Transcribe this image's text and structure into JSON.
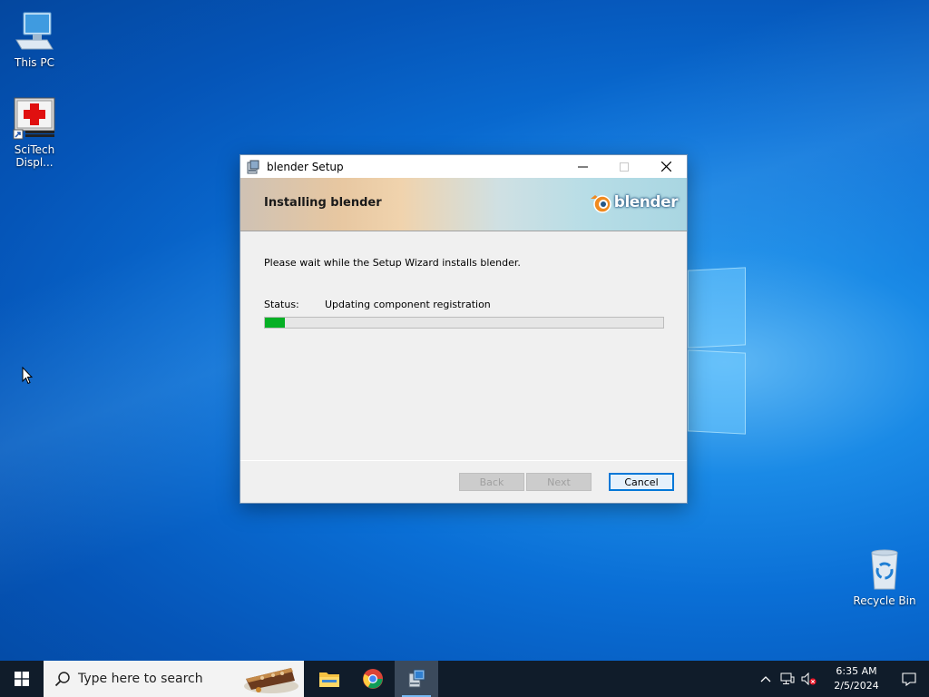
{
  "desktop": {
    "icons": [
      {
        "label": "This PC"
      },
      {
        "label": "SciTech Displ..."
      },
      {
        "label": "Recycle Bin"
      }
    ]
  },
  "dialog": {
    "title": "blender Setup",
    "banner_heading": "Installing blender",
    "logo_text": "blender",
    "description": "Please wait while the Setup Wizard installs blender.",
    "status_label": "Status:",
    "status_value": "Updating component registration",
    "progress_percent": 5,
    "buttons": {
      "back": "Back",
      "next": "Next",
      "cancel": "Cancel"
    }
  },
  "taskbar": {
    "search_placeholder": "Type here to search",
    "clock_time": "6:35 AM",
    "clock_date": "2/5/2024"
  },
  "colors": {
    "accent": "#0078d7",
    "progress_fill": "#06b025",
    "taskbar": "#101c2a"
  }
}
